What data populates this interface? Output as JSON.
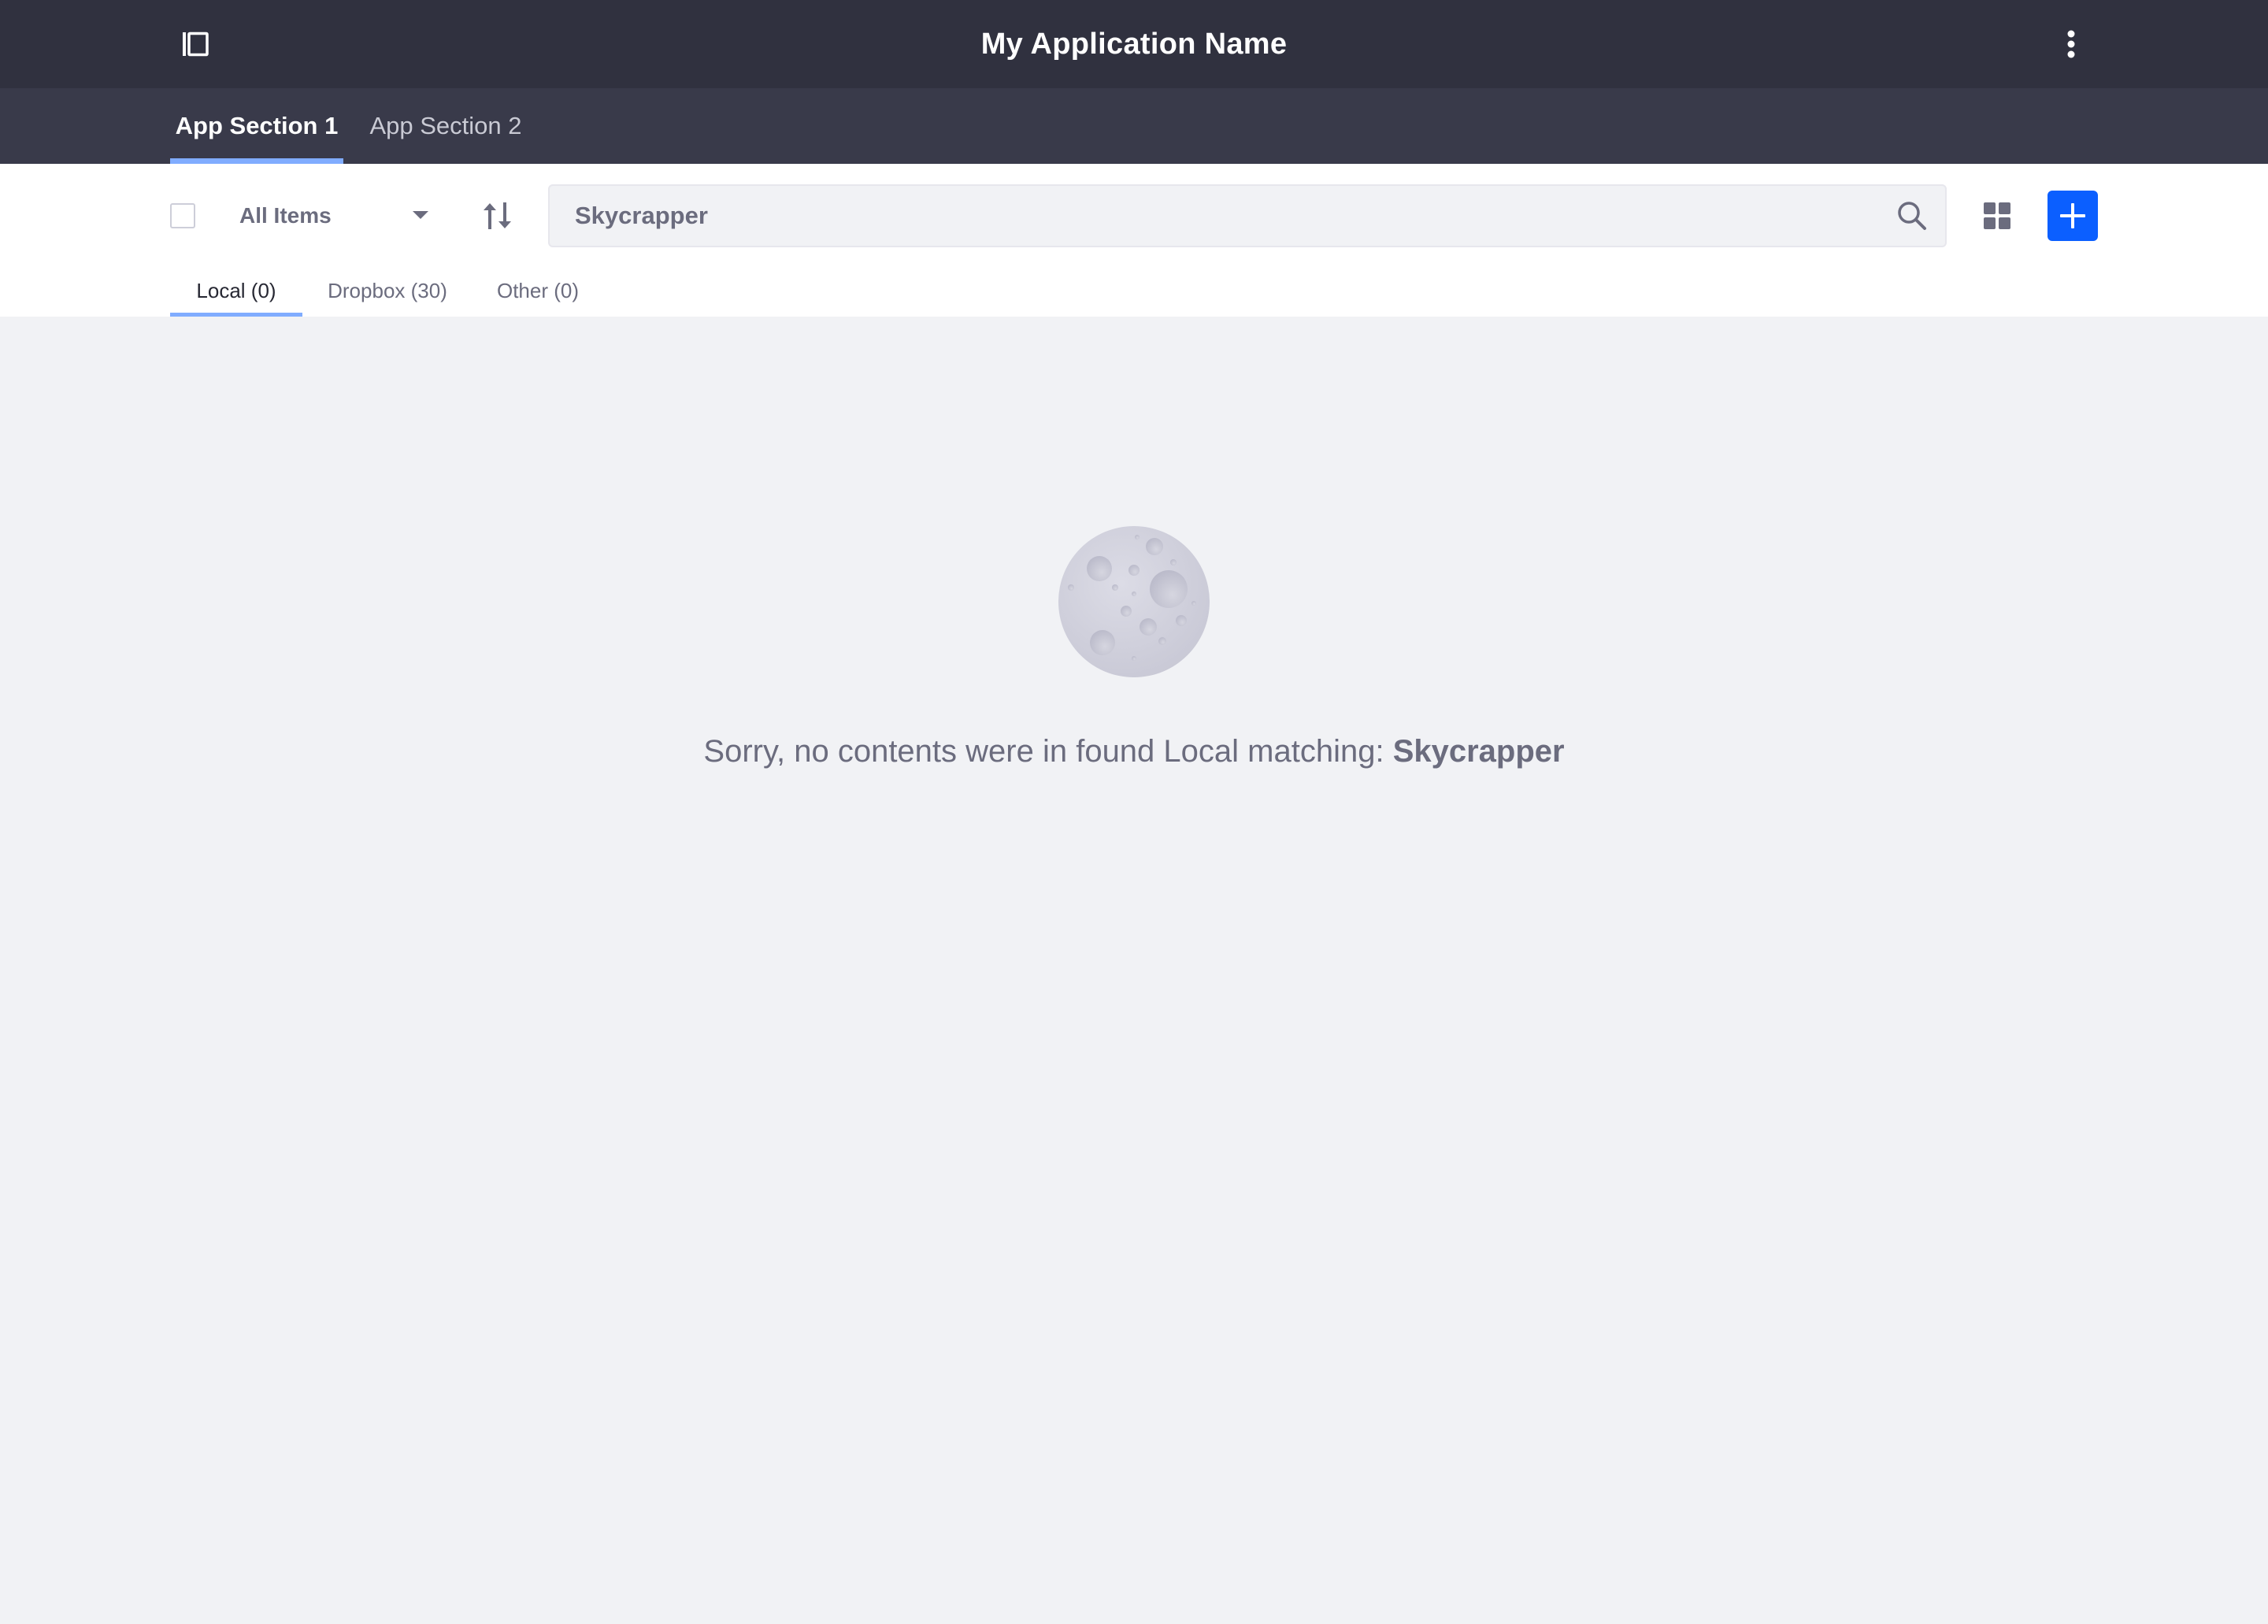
{
  "app_bar": {
    "title": "My Application Name",
    "sidebar_toggle_icon": "sidebar-panel-icon",
    "menu_icon": "vertical-ellipsis-icon"
  },
  "section_nav": {
    "tabs": [
      {
        "label": "App Section 1",
        "active": true
      },
      {
        "label": "App Section 2",
        "active": false
      }
    ]
  },
  "toolbar": {
    "filter": {
      "selected": "All Items"
    },
    "sort_icon": "sort-arrows-icon",
    "search": {
      "value": "Skycrapper",
      "icon": "search-icon"
    },
    "view_toggle_icon": "grid-view-icon",
    "add_icon": "plus-icon"
  },
  "source_tabs": [
    {
      "label": "Local (0)",
      "active": true
    },
    {
      "label": "Dropbox (30)",
      "active": false
    },
    {
      "label": "Other (0)",
      "active": false
    }
  ],
  "empty_state": {
    "illustration": "moon-icon",
    "message": "Sorry, no contents were in found Local matching: ",
    "query": "Skycrapper"
  },
  "colors": {
    "app_bar_bg": "#30313f",
    "nav_bg": "#393a4a",
    "accent": "#0b5fff",
    "tab_indicator": "#80acff",
    "page_bg": "#f1f2f5",
    "secondary_text": "#6b6c7e"
  }
}
